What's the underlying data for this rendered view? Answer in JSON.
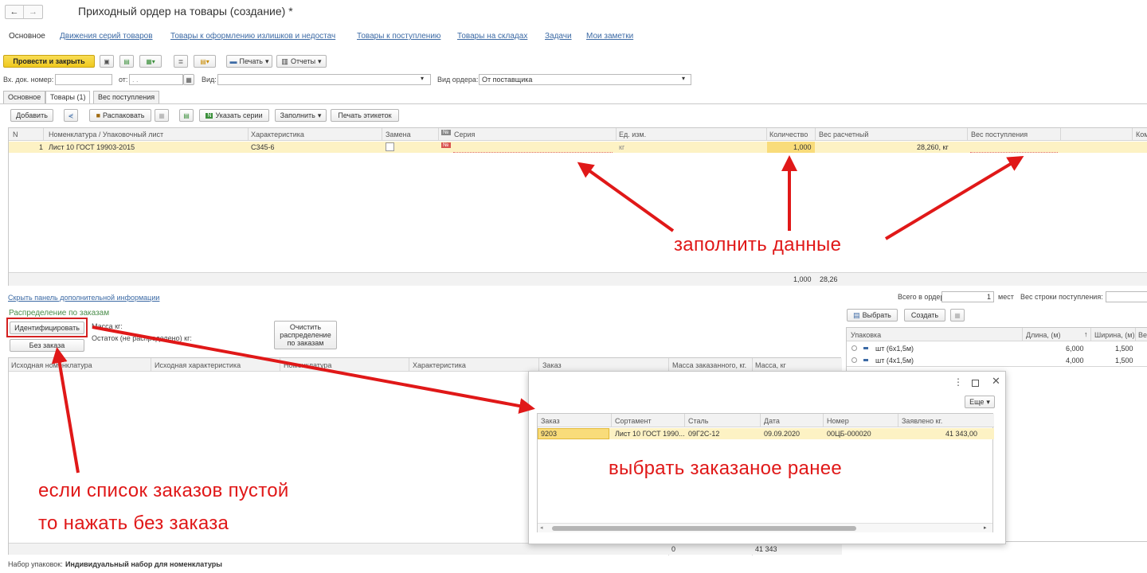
{
  "header": {
    "title": "Приходный ордер на товары (создание) *",
    "back_icon": "←",
    "fwd_icon": "→"
  },
  "nav": {
    "tabs": [
      "Основное",
      "Движения серий товаров",
      "Товары к оформлению излишков и недостач",
      "Товары к поступлению",
      "Товары на складах",
      "Задачи",
      "Мои заметки"
    ]
  },
  "toolbar": {
    "post_close": "Провести и закрыть",
    "print": "Печать",
    "reports": "Отчеты"
  },
  "form": {
    "doc_num_label": "Вх. док. номер:",
    "from_label": "от:",
    "from_value": ". .",
    "kind_label": "Вид:",
    "order_kind_label": "Вид ордера:",
    "order_kind_value": "От поставщика"
  },
  "inner_tabs": [
    "Основное",
    "Товары (1)",
    "Вес поступления"
  ],
  "goods_toolbar": {
    "add": "Добавить",
    "unpack": "Распаковать",
    "series": "Указать серии",
    "fill": "Заполнить",
    "print_labels": "Печать этикеток"
  },
  "goods_table": {
    "columns": [
      "N",
      "Номенклатура / Упаковочный лист",
      "Характеристика",
      "Замена",
      "Серия",
      "Ед. изм.",
      "Количество",
      "Вес расчетный",
      "Вес поступления",
      "Ком"
    ],
    "rows": [
      {
        "n": "1",
        "nom": "Лист 10 ГОСТ 19903-2015",
        "char": "С345-6",
        "unit": "кг",
        "qty": "1,000",
        "weight": "28,260, кг"
      }
    ],
    "footer_qty": "1,000",
    "footer_weight": "28,26"
  },
  "info": {
    "hide_link": "Скрыть панель дополнительной информации",
    "total_label": "Всего в ордере:",
    "total_value": "1",
    "places": "мест",
    "row_weight_label": "Вес строки поступления:"
  },
  "distribution": {
    "title": "Распределение по заказам",
    "identify": "Идентифицировать",
    "mass_label": "Масса кг:",
    "rest_label": "Остаток (не распределено) кг:",
    "clear": "Очистить распределение по заказам",
    "without_order": "Без заказа",
    "columns": [
      "Исходная номенклатура",
      "Исходная характеристика",
      "Номенклатура",
      "Характеристика",
      "Заказ",
      "Масса заказанного, кг.",
      "Масса, кг"
    ],
    "footer_a": "0",
    "footer_b": "41 343"
  },
  "packaging": {
    "select": "Выбрать",
    "create": "Создать",
    "columns": [
      "Упаковка",
      "Длина, (м)",
      "Ширина, (м)",
      "Ве"
    ],
    "rows": [
      {
        "name": "шт (6х1,5м)",
        "len": "6,000",
        "wid": "1,500"
      },
      {
        "name": "шт (4х1,5м)",
        "len": "4,000",
        "wid": "1,500"
      }
    ]
  },
  "popup": {
    "more": "Еще",
    "columns": [
      "Заказ",
      "Сортамент",
      "Сталь",
      "Дата",
      "Номер",
      "Заявлено кг."
    ],
    "rows": [
      {
        "order": "9203",
        "assortment": "Лист 10 ГОСТ 1990...",
        "steel": "09Г2С-12",
        "date": "09.09.2020",
        "number": "00ЦБ-000020",
        "declared": "41 343,00"
      }
    ]
  },
  "bottom": {
    "set_label": "Набор упаковок:",
    "set_value": "Индивидуальный набор для номенклатуры"
  },
  "annotations": {
    "fill_data": "заполнить данные",
    "choose_prev": "выбрать заказаное ранее",
    "empty_line1": "если список заказов пустой",
    "empty_line2": "то нажать без заказа"
  },
  "colors": {
    "accent_yellow": "#f6d43c",
    "row_highlight": "#fdf2c4",
    "annotation_red": "#e01818",
    "series_red": "#d9534f"
  }
}
